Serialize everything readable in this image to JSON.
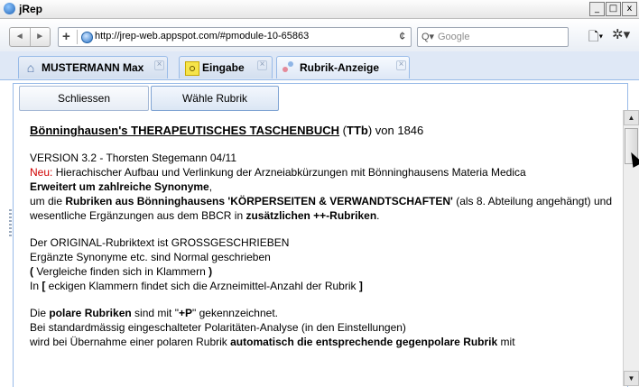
{
  "window": {
    "title": "jRep",
    "min": "_",
    "max": "□",
    "close": "x"
  },
  "toolbar": {
    "back": "◄",
    "forward": "►",
    "add": "+",
    "url": "http://jrep-web.appspot.com/#pmodule-10-65863",
    "reload": "¢",
    "search_icon": "Q▾",
    "search_placeholder": "Google",
    "page_icon": "🗋▾",
    "gear_icon": "✲▾"
  },
  "tabs": [
    {
      "label": "MUSTERMANN Max",
      "icon": "home-icon"
    },
    {
      "label": "Eingabe",
      "icon": "edit-icon"
    },
    {
      "label": "Rubrik-Anzeige",
      "icon": "rubrik-icon"
    }
  ],
  "tab_close": "×",
  "buttons": {
    "close": "Schliessen",
    "choose": "Wähle Rubrik"
  },
  "doc": {
    "heading_title": "Bönninghausen's THERAPEUTISCHES TASCHENBUCH",
    "heading_open": " (",
    "heading_abbr": "TTb",
    "heading_close": ") von 1846",
    "version": "VERSION 3.2 - Thorsten Stegemann 04/11",
    "neu": "Neu:",
    "neu_text": " Hierachischer Aufbau und Verlinkung der Arzneiabkürzungen mit Bönninghausens Materia Medica",
    "synonyme": "Erweitert um zahlreiche Synonyme",
    "comma": ",",
    "um_die": "um die ",
    "rubriken_aus": "Rubriken aus Bönninghausens 'KÖRPERSEITEN & VERWANDTSCHAFTEN'",
    "als8": " (als 8. Abteilung angehängt) und",
    "wesentliche": "wesentliche Ergänzungen aus dem BBCR in ",
    "zusaetzlich": "zusätzlichen ++-Rubriken",
    "dot": ".",
    "original": "Der ORIGINAL-Rubriktext ist GROSSGESCHRIEBEN",
    "ergaenzt": "Ergänzte Synonyme etc. sind Normal geschrieben",
    "paren_open": "(",
    "vergleiche": " Vergleiche finden sich in Klammern ",
    "paren_close": ")",
    "in": "In ",
    "bracket_open": "[",
    "eckigen": " eckigen Klammern findet sich die Arzneimittel-Anzahl der Rubrik ",
    "bracket_close": "]",
    "die": "Die ",
    "polare": "polare Rubriken",
    "sind_mit": " sind mit \"",
    "plusp": "+P",
    "gekenn": "\" gekennzeichnet.",
    "bei": "Bei standardmässig eingeschalteter Polaritäten-Analyse (in den Einstellungen)",
    "wird": "wird bei Übernahme einer polaren Rubrik ",
    "automatisch": "automatisch die entsprechende gegenpolare Rubrik",
    "mit": " mit"
  },
  "scrollbar": {
    "up": "▲",
    "down": "▼"
  },
  "colors": {
    "accent_red": "#d00000",
    "tab_border": "#99bbe8",
    "tab_bg": "#dfe8f6"
  }
}
